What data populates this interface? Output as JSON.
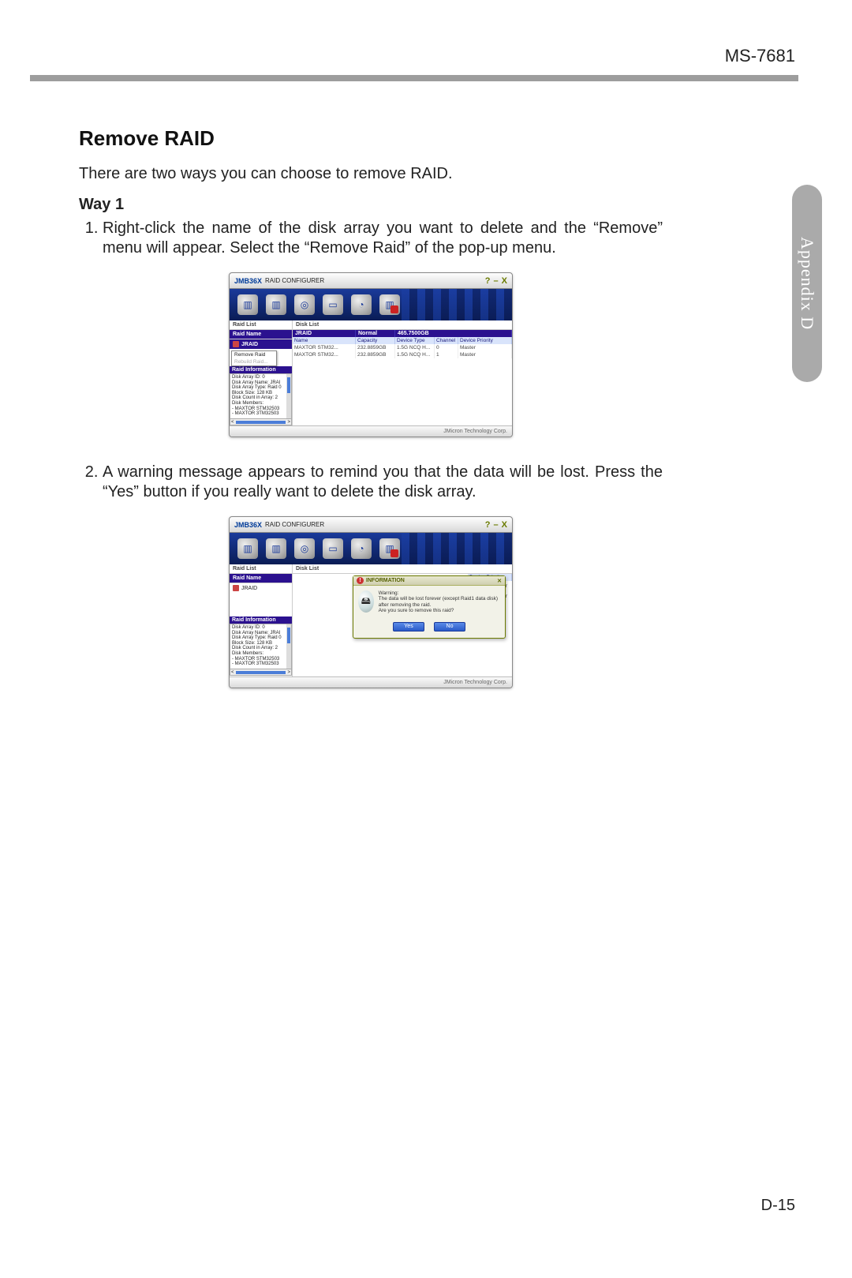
{
  "model": "MS-7681",
  "side_tab": "Appendix D",
  "title": "Remove RAID",
  "intro": "There are two ways you can choose to remove RAID.",
  "way_label": "Way 1",
  "steps": {
    "s1": "Right-click the name of the disk array you want to delete and the “Remove” menu will appear. Select the “Remove Raid” of the pop-up menu.",
    "s2": "A warning message appears to remind you that the data will be lost. Press the “Yes” button if you really want to delete the disk array."
  },
  "app": {
    "brand": "JMB36X",
    "subtitle": "RAID CONFIGURER",
    "win": {
      "help": "?",
      "min": "–",
      "close": "X"
    },
    "footer": "JMicron Technology Corp."
  },
  "panel": {
    "raid_list_title": "Raid List",
    "raid_name_title": "Raid Name",
    "raid_item": "JRAID",
    "disk_list_title": "Disk List",
    "raid_info_title": "Raid Information",
    "dlist_head": {
      "jname": "JRAID",
      "status": "Normal",
      "capacity": "465.7500GB"
    },
    "cols": {
      "name": "Name",
      "capacity": "Capacity",
      "devtype": "Device Type",
      "channel": "Channel",
      "priority": "Device Priority"
    },
    "rows": [
      {
        "name": "MAXTOR STM32...",
        "cap": "232.8859GB",
        "dt": "1.5G NCQ H...",
        "ch": "0",
        "dp": "Master"
      },
      {
        "name": "MAXTOR STM32...",
        "cap": "232.8859GB",
        "dt": "1.5G NCQ H...",
        "ch": "1",
        "dp": "Master"
      }
    ],
    "info_lines": [
      "Disk Array ID: 0",
      "Disk Array Name: JRAI",
      "Disk Array Type: Raid 0",
      "Block Size: 128 KB",
      "Disk Count in Array: 2",
      "Disk Members:",
      "- MAXTOR STM32503",
      "- MAXTOR 3TM32503"
    ],
    "ctx": {
      "remove": "Remove Raid",
      "rebuild": "Rebuild Raid..."
    }
  },
  "dialog": {
    "title": "INFORMATION",
    "warning_label": "Warning:",
    "line1": "The data will be lost forever (except Raid1 data disk) after removing the raid.",
    "line2": "Are you sure to remove this raid?",
    "yes": "Yes",
    "no": "No"
  },
  "page_number": "D-15"
}
